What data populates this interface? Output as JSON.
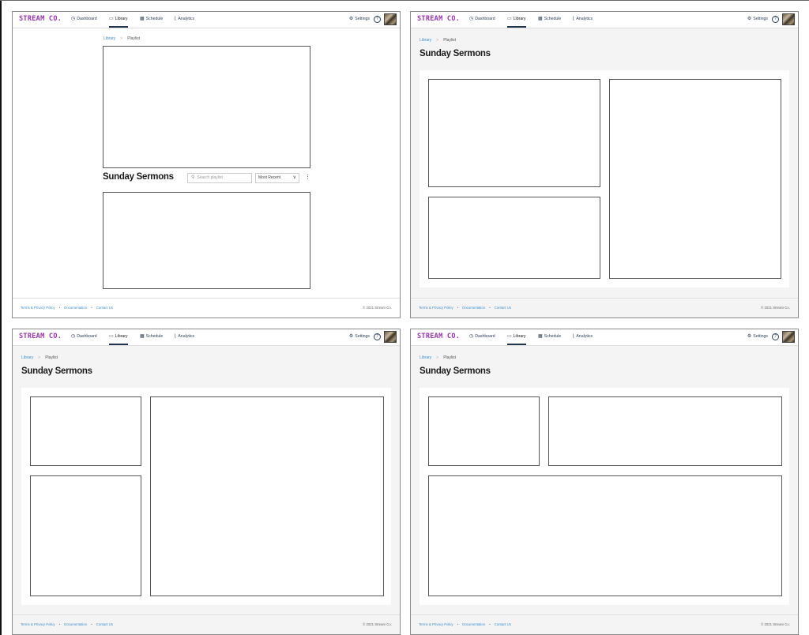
{
  "brand": "STREAM CO.",
  "nav": {
    "dashboard": "Dashboard",
    "library": "Library",
    "schedule": "Schedule",
    "analytics": "Analytics",
    "settings": "Settings",
    "help": "?"
  },
  "breadcrumb": {
    "root": "Library",
    "separator": ">",
    "current": "Playlist"
  },
  "title": "Sunday Sermons",
  "search": {
    "placeholder": "Search playlist"
  },
  "sort": {
    "selected": "Most Recent"
  },
  "footer": {
    "terms": "Terms & Privacy Policy",
    "docs": "Documentation",
    "contact": "Contact Us",
    "dot": "•",
    "copyright": "© 2021 Stream Co."
  },
  "icons": {
    "dashboard": "dashboard-icon",
    "library": "video-icon",
    "schedule": "calendar-icon",
    "analytics": "chart-icon",
    "settings": "gear-icon",
    "help": "help-icon",
    "search": "search-icon",
    "sort": "chevron-down-icon",
    "more": "kebab-icon"
  },
  "colors": {
    "brand": "#9b2fb6",
    "link": "#3b8fd0",
    "nav_text": "#2d4059"
  }
}
